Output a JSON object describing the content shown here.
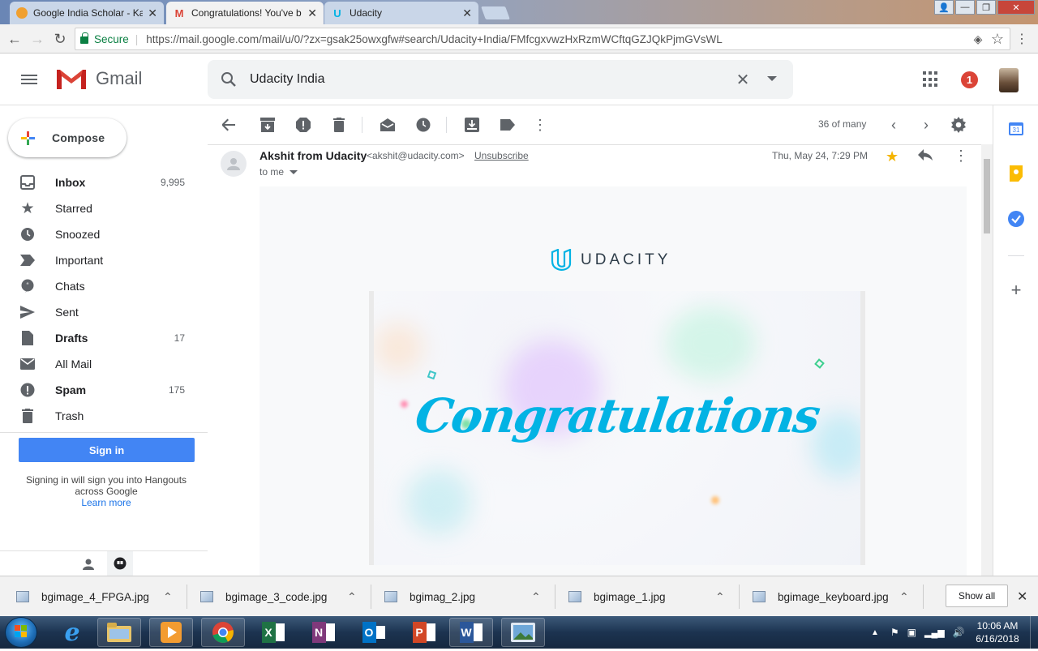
{
  "browser": {
    "tabs": [
      {
        "title": "Google India Scholar - Ka",
        "active": false
      },
      {
        "title": "Congratulations! You've b",
        "active": true
      },
      {
        "title": "Udacity",
        "active": false
      }
    ],
    "secure_label": "Secure",
    "url": "https://mail.google.com/mail/u/0/?zx=gsak25owxgfw#search/Udacity+India/FMfcgxvwzHxRzmWCftqGZJQkPjmGVsWL"
  },
  "gmail": {
    "app_name": "Gmail",
    "search_value": "Udacity India",
    "notification_count": "1",
    "compose_label": "Compose",
    "nav": [
      {
        "label": "Inbox",
        "count": "9,995",
        "bold": true,
        "icon": "inbox-icon"
      },
      {
        "label": "Starred",
        "count": "",
        "bold": false,
        "icon": "star-icon"
      },
      {
        "label": "Snoozed",
        "count": "",
        "bold": false,
        "icon": "clock-icon"
      },
      {
        "label": "Important",
        "count": "",
        "bold": false,
        "icon": "important-icon"
      },
      {
        "label": "Chats",
        "count": "",
        "bold": false,
        "icon": "chat-icon"
      },
      {
        "label": "Sent",
        "count": "",
        "bold": false,
        "icon": "send-icon"
      },
      {
        "label": "Drafts",
        "count": "17",
        "bold": true,
        "icon": "draft-icon"
      },
      {
        "label": "All Mail",
        "count": "",
        "bold": false,
        "icon": "mail-icon"
      },
      {
        "label": "Spam",
        "count": "175",
        "bold": true,
        "icon": "spam-icon"
      },
      {
        "label": "Trash",
        "count": "",
        "bold": false,
        "icon": "trash-icon"
      }
    ],
    "hangouts": {
      "signin_label": "Sign in",
      "signin_text": "Signing in will sign you into Hangouts across Google",
      "learn_more": "Learn more"
    },
    "pager": "36 of many",
    "message": {
      "sender_name": "Akshit from Udacity",
      "sender_email": "<akshit@udacity.com>",
      "unsubscribe": "Unsubscribe",
      "to": "to me",
      "date": "Thu, May 24, 7:29 PM",
      "brand": "UDACITY",
      "banner_text": "Congratulations"
    }
  },
  "downloads": {
    "files": [
      "bgimage_4_FPGA.jpg",
      "bgimage_3_code.jpg",
      "bgimag_2.jpg",
      "bgimage_1.jpg",
      "bgimage_keyboard.jpg"
    ],
    "show_all": "Show all"
  },
  "taskbar": {
    "apps": [
      "explorer",
      "media",
      "chrome",
      "excel",
      "onenote",
      "outlook",
      "powerpoint",
      "word",
      "photo"
    ],
    "time": "10:06 AM",
    "date": "6/16/2018"
  },
  "colors": {
    "accent": "#4285f4",
    "badge": "#db4437",
    "star": "#f4b400",
    "udacity": "#02b3e4"
  }
}
